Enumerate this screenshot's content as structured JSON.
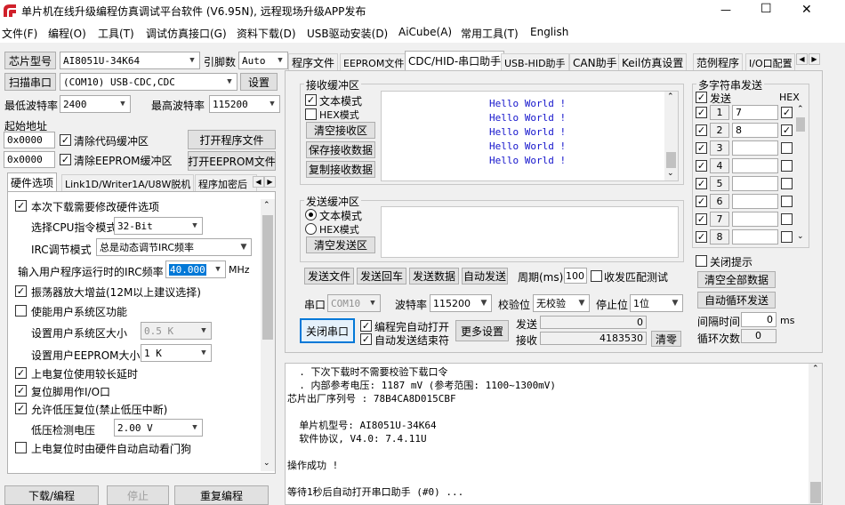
{
  "window": {
    "title": "单片机在线升级编程仿真调试平台软件 (V6.95N), 远程现场升级APP发布",
    "controls": {
      "minimize": "—",
      "maximize": "☐",
      "close": "✕"
    }
  },
  "menu": [
    "文件(F)",
    "编程(O)",
    "工具(T)",
    "调试仿真接口(G)",
    "资料下载(D)",
    "USB驱动安装(D)",
    "AiCube(A)",
    "常用工具(T)",
    "English"
  ],
  "left": {
    "chip_label": "芯片型号",
    "chip_value": "AI8051U-34K64",
    "pin_label": "引脚数",
    "pin_value": "Auto",
    "scan_button": "扫描串口",
    "port_value": "(COM10) USB-CDC,CDC",
    "settings_button": "设置",
    "min_baud_label": "最低波特率",
    "min_baud_value": "2400",
    "max_baud_label": "最高波特率",
    "max_baud_value": "115200",
    "start_addr_label": "起始地址",
    "addr1": "0x0000",
    "clear_code_label": "清除代码缓冲区",
    "open_prog_button": "打开程序文件",
    "addr2": "0x0000",
    "clear_eeprom_label": "清除EEPROM缓冲区",
    "open_eeprom_button": "打开EEPROM文件",
    "tabs": [
      "硬件选项",
      "Link1D/Writer1A/U8W脱机",
      "程序加密后"
    ],
    "hw": {
      "modify_label": "本次下载需要修改硬件选项",
      "cpu_mode_label": "选择CPU指令模式",
      "cpu_mode_value": "32-Bit",
      "irc_mode_label": "IRC调节模式",
      "irc_mode_value": "总是动态调节IRC频率",
      "irc_freq_label": "输入用户程序运行时的IRC频率",
      "irc_freq_value": "40.000",
      "irc_unit": "MHz",
      "osc_label": "振荡器放大增益(12M以上建议选择)",
      "user_sys_label": "使能用户系统区功能",
      "sys_size_label": "设置用户系统区大小",
      "sys_size_value": "0.5 K",
      "eeprom_size_label": "设置用户EEPROM大小",
      "eeprom_size_value": "1  K",
      "por_delay_label": "上电复位使用较长延时",
      "reset_pin_label": "复位脚用作I/O口",
      "lvr_label": "允许低压复位(禁止低压中断)",
      "lvd_label": "低压检测电压",
      "lvd_value": "2.00 V",
      "wdt_label": "上电复位时由硬件自动启动看门狗"
    },
    "bottom_buttons": [
      "下载/编程",
      "停止",
      "重复编程"
    ]
  },
  "right": {
    "tabs": [
      "程序文件",
      "EEPROM文件",
      "CDC/HID-串口助手",
      "USB-HID助手",
      "CAN助手",
      "Keil仿真设置",
      "范例程序",
      "I/O口配置"
    ],
    "rx": {
      "title": "接收缓冲区",
      "text_mode": "文本模式",
      "hex_mode": "HEX模式",
      "clear": "清空接收区",
      "save": "保存接收数据",
      "copy": "复制接收数据",
      "lines": [
        "Hello World !",
        "Hello World !",
        "Hello World !",
        "Hello World !",
        "Hello World !"
      ]
    },
    "tx": {
      "title": "发送缓冲区",
      "text_mode": "文本模式",
      "hex_mode": "HEX模式",
      "clear": "清空发送区"
    },
    "action_buttons": [
      "发送文件",
      "发送回车",
      "发送数据",
      "自动发送"
    ],
    "period_label": "周期(ms)",
    "period_value": "100",
    "match_label": "收发匹配测试",
    "port_label": "串口",
    "port_value": "COM10",
    "baud_label": "波特率",
    "baud_value": "115200",
    "parity_label": "校验位",
    "parity_value": "无校验",
    "stop_label": "停止位",
    "stop_value": "1位",
    "close_port": "关闭串口",
    "auto_open": "编程完自动打开",
    "auto_send_end": "自动发送结束符",
    "more_settings": "更多设置",
    "send_label": "发送",
    "send_count": "0",
    "recv_label": "接收",
    "recv_count": "4183530",
    "clear_counts": "清零",
    "multi": {
      "title": "多字符串发送",
      "send_col": "发送",
      "hex_col": "HEX",
      "rows": [
        {
          "n": "1",
          "text": "7"
        },
        {
          "n": "2",
          "text": "8"
        },
        {
          "n": "3",
          "text": ""
        },
        {
          "n": "4",
          "text": ""
        },
        {
          "n": "5",
          "text": ""
        },
        {
          "n": "6",
          "text": ""
        },
        {
          "n": "7",
          "text": ""
        },
        {
          "n": "8",
          "text": ""
        }
      ],
      "close_hint": "关闭提示",
      "clear_all": "清空全部数据",
      "auto_cycle": "自动循环发送",
      "interval_label": "间隔时间",
      "interval_value": "0",
      "interval_unit": "ms",
      "cycle_label": "循环次数",
      "cycle_value": "0"
    }
  },
  "log": {
    "lines": [
      "  . 下次下载时不需要校验下载口令",
      "  . 内部参考电压: 1187 mV (参考范围: 1100~1300mV)",
      "芯片出厂序列号 : 78B4CA8D015CBF",
      "",
      "  单片机型号: AI8051U-34K64",
      "  软件协议, V4.0: 7.4.11U",
      "",
      "操作成功 !",
      "",
      "等待1秒后自动打开串口助手 (#0) ..."
    ]
  }
}
